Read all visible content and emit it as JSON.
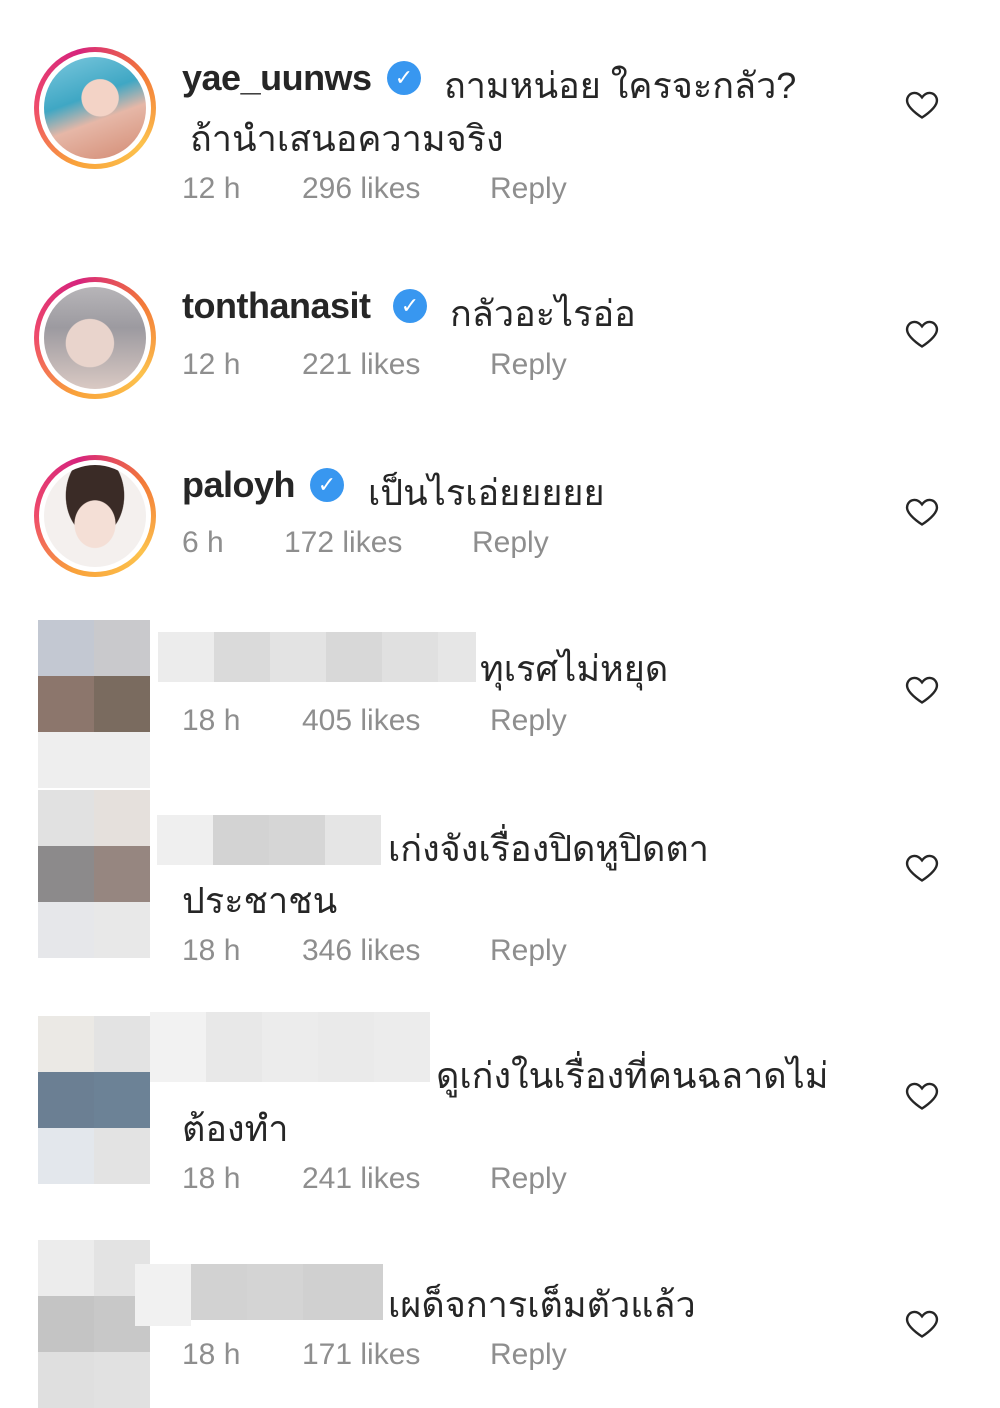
{
  "reply_label": "Reply",
  "comments": [
    {
      "username": "yae_uunws",
      "verified": true,
      "text_line1": "ถามหน่อย ใครจะกลัว?",
      "text_line2": "ถ้านำเสนอความจริง",
      "time": "12 h",
      "likes": "296 likes"
    },
    {
      "username": "tonthanasit",
      "verified": true,
      "text_line1": "กลัวอะไรอ่อ",
      "time": "12 h",
      "likes": "221 likes"
    },
    {
      "username": "paloyh",
      "verified": true,
      "text_line1": "เป็นไรเอ่ยยยยย",
      "time": "6 h",
      "likes": "172 likes"
    },
    {
      "username": "",
      "text_line1": "ทุเรศไม่หยุด",
      "time": "18 h",
      "likes": "405 likes"
    },
    {
      "username": "",
      "text_line1": "เก่งจังเรื่องปิดหูปิดตา",
      "text_line2": "ประชาชน",
      "time": "18 h",
      "likes": "346 likes"
    },
    {
      "username": "",
      "text_line1": "ดูเก่งในเรื่องที่คนฉลาดไม่",
      "text_line2": "ต้องทำ",
      "time": "18 h",
      "likes": "241 likes"
    },
    {
      "username": "",
      "text_line1": "เผด็จการเต็มตัวแล้ว",
      "time": "18 h",
      "likes": "171 likes"
    }
  ],
  "icons": {
    "verified": "verified-badge-icon",
    "like": "heart-outline-icon"
  },
  "colors": {
    "verified_blue": "#3897f0",
    "meta_gray": "#8e8e8e",
    "text": "#262626"
  }
}
